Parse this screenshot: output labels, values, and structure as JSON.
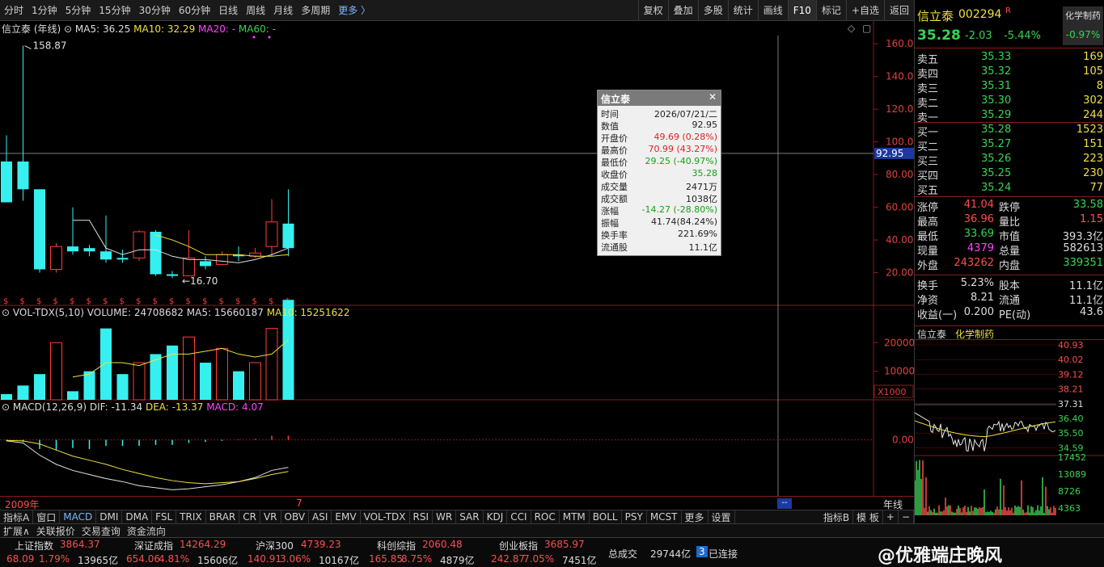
{
  "top_periods": [
    "分时",
    "1分钟",
    "5分钟",
    "15分钟",
    "30分钟",
    "60分钟",
    "日线",
    "周线",
    "月线",
    "多周期",
    "更多 〉"
  ],
  "top_tools": [
    "复权",
    "叠加",
    "多股",
    "统计",
    "画线",
    "F10",
    "标记",
    "+自选",
    "返回"
  ],
  "legend_main": {
    "name": "信立泰 (年线)",
    "ma5": "MA5: 36.25",
    "ma10": "MA10: 32.29",
    "ma20": "MA20: -",
    "ma60": "MA60: -"
  },
  "annotations": {
    "high": "158.87",
    "low": "16.70"
  },
  "price_axis": [
    "160.00",
    "140.00",
    "120.00",
    "100.00",
    "80.00",
    "60.00",
    "40.00",
    "20.00"
  ],
  "crosshair_value": "92.95",
  "legend_vol": {
    "name": "VOL-TDX(5,10)",
    "volume": "VOLUME: 24708682",
    "ma5": "MA5: 15660187",
    "ma10": "MA10: 15251622"
  },
  "vol_axis": [
    "20000",
    "10000"
  ],
  "vol_unit": "X1000",
  "legend_macd": {
    "name": "MACD(12,26,9)",
    "dif": "DIF: -11.34",
    "dea": "DEA: -13.37",
    "macd": "MACD: 4.07"
  },
  "macd_axis": "0.00",
  "time_axis": {
    "start": "2009年",
    "mark": "7"
  },
  "period_label": "年线",
  "tooltip": {
    "title": "信立泰",
    "rows": [
      {
        "k": "时间",
        "v": "2026/07/21/二",
        "c": "#222"
      },
      {
        "k": "数值",
        "v": "92.95",
        "c": "#222"
      },
      {
        "k": "开盘价",
        "v": "49.69 (0.28%)",
        "c": "#e02020"
      },
      {
        "k": "最高价",
        "v": "70.99 (43.27%)",
        "c": "#e02020"
      },
      {
        "k": "最低价",
        "v": "29.25 (-40.97%)",
        "c": "#14a014"
      },
      {
        "k": "收盘价",
        "v": "35.28",
        "c": "#14a014"
      },
      {
        "k": "成交量",
        "v": "2471万",
        "c": "#222"
      },
      {
        "k": "成交额",
        "v": "1038亿",
        "c": "#222"
      },
      {
        "k": "涨幅",
        "v": "-14.27 (-28.80%)",
        "c": "#14a014"
      },
      {
        "k": "振幅",
        "v": "41.74(84.24%)",
        "c": "#222"
      },
      {
        "k": "换手率",
        "v": "221.69%",
        "c": "#222"
      },
      {
        "k": "流通股",
        "v": "11.1亿",
        "c": "#222"
      }
    ]
  },
  "indicator_tabs": [
    "指标A",
    "窗口",
    "MACD",
    "DMI",
    "DMA",
    "FSL",
    "TRIX",
    "BRAR",
    "CR",
    "VR",
    "OBV",
    "ASI",
    "EMV",
    "VOL-TDX",
    "RSI",
    "WR",
    "SAR",
    "KDJ",
    "CCI",
    "ROC",
    "MTM",
    "BOLL",
    "PSY",
    "MCST",
    "更多",
    "设置"
  ],
  "indicator_right": [
    "指标B",
    "模 板",
    "+",
    "−"
  ],
  "bottom_tabs": [
    "扩展∧",
    "关联报价",
    "交易查询",
    "资金流向"
  ],
  "right_panel": {
    "name": "信立泰",
    "code": "002294",
    "tag": "R",
    "industry": "化学制药",
    "industry_change": "-0.97%",
    "price": "35.28",
    "change": "-2.03",
    "pct": "-5.44%",
    "asks": [
      {
        "l": "卖五",
        "p": "35.33",
        "v": "169"
      },
      {
        "l": "卖四",
        "p": "35.32",
        "v": "105"
      },
      {
        "l": "卖三",
        "p": "35.31",
        "v": "8"
      },
      {
        "l": "卖二",
        "p": "35.30",
        "v": "302"
      },
      {
        "l": "卖一",
        "p": "35.29",
        "v": "244"
      }
    ],
    "bids": [
      {
        "l": "买一",
        "p": "35.28",
        "v": "1523"
      },
      {
        "l": "买二",
        "p": "35.27",
        "v": "151"
      },
      {
        "l": "买三",
        "p": "35.26",
        "v": "223"
      },
      {
        "l": "买四",
        "p": "35.25",
        "v": "230"
      },
      {
        "l": "买五",
        "p": "35.24",
        "v": "77"
      }
    ],
    "stats": [
      {
        "a": "涨停",
        "av": "41.04",
        "ac": "red",
        "b": "跌停",
        "bv": "33.58",
        "bc": "grn"
      },
      {
        "a": "最高",
        "av": "36.96",
        "ac": "red",
        "b": "量比",
        "bv": "1.15",
        "bc": "red"
      },
      {
        "a": "最低",
        "av": "33.69",
        "ac": "grn",
        "b": "市值",
        "bv": "393.3亿",
        "bc": "wht"
      },
      {
        "a": "现量",
        "av": "4379",
        "ac": "mag",
        "b": "总量",
        "bv": "582613",
        "bc": "wht"
      },
      {
        "a": "外盘",
        "av": "243262",
        "ac": "red",
        "b": "内盘",
        "bv": "339351",
        "bc": "grn"
      }
    ],
    "stats2": [
      {
        "a": "换手",
        "av": "5.23%",
        "b": "股本",
        "bv": "11.1亿"
      },
      {
        "a": "净资",
        "av": "8.21",
        "b": "流通",
        "bv": "11.1亿"
      },
      {
        "a": "收益(一)",
        "av": "0.200",
        "b": "PE(动)",
        "bv": "43.6"
      }
    ],
    "mini_title": "信立泰",
    "mini_industry": "化学制药",
    "mini_axis": [
      "40.93",
      "40.02",
      "39.12",
      "38.21",
      "37.31",
      "36.40",
      "35.50",
      "34.59"
    ],
    "mini_vol_axis": [
      "17452",
      "13089",
      "8726",
      "4363"
    ]
  },
  "index_bar": [
    {
      "name": "上证指数",
      "val": "3864.37",
      "chg": "68.09",
      "pct": "1.79%",
      "amt": "13965亿"
    },
    {
      "name": "深证成指",
      "val": "14264.29",
      "chg": "654.06",
      "pct": "4.81%",
      "amt": "15606亿"
    },
    {
      "name": "沪深300",
      "val": "4739.23",
      "chg": "140.91",
      "pct": "3.06%",
      "amt": "10167亿"
    },
    {
      "name": "科创综指",
      "val": "2060.48",
      "chg": "165.85",
      "pct": "8.75%",
      "amt": "4879亿"
    },
    {
      "name": "创业板指",
      "val": "3685.97",
      "chg": "242.87",
      "pct": "7.05%",
      "amt": "7451亿"
    }
  ],
  "total_label": "总成交",
  "total_val": "29744亿",
  "conn_num": "3",
  "conn_label": "已连接",
  "watermark": "@优雅端庄晚风",
  "chart_data": {
    "type": "candlestick",
    "candles": [
      {
        "o": 88,
        "c": 63,
        "h": 104,
        "l": 63
      },
      {
        "o": 88,
        "c": 71,
        "h": 158.87,
        "l": 64
      },
      {
        "o": 71,
        "c": 22,
        "h": 71,
        "l": 20
      },
      {
        "o": 22,
        "c": 36,
        "h": 38,
        "l": 20
      },
      {
        "o": 36,
        "c": 33,
        "h": 60,
        "l": 31
      },
      {
        "o": 35,
        "c": 33,
        "h": 37,
        "l": 30
      },
      {
        "o": 33,
        "c": 28,
        "h": 55,
        "l": 26
      },
      {
        "o": 29,
        "c": 28,
        "h": 34,
        "l": 26
      },
      {
        "o": 29,
        "c": 45,
        "h": 46,
        "l": 27
      },
      {
        "o": 45,
        "c": 19,
        "h": 46,
        "l": 18
      },
      {
        "o": 19,
        "c": 18,
        "h": 21,
        "l": 16.7
      },
      {
        "o": 18,
        "c": 29,
        "h": 46,
        "l": 18
      },
      {
        "o": 27,
        "c": 24,
        "h": 30,
        "l": 22
      },
      {
        "o": 25,
        "c": 31,
        "h": 33,
        "l": 25
      },
      {
        "o": 31,
        "c": 30,
        "h": 36,
        "l": 27
      },
      {
        "o": 30,
        "c": 32,
        "h": 35,
        "l": 29
      },
      {
        "o": 36,
        "c": 51,
        "h": 65,
        "l": 30
      },
      {
        "o": 50,
        "c": 35,
        "h": 71,
        "l": 30
      }
    ],
    "ma5": [
      null,
      null,
      null,
      null,
      52,
      52,
      35,
      31,
      34,
      34,
      30,
      28,
      28,
      27,
      26,
      28,
      31,
      35
    ],
    "ma10": [
      null,
      null,
      null,
      null,
      null,
      null,
      null,
      null,
      null,
      43,
      40,
      36,
      31,
      31,
      31,
      30,
      30,
      31
    ],
    "volume": [
      2,
      5,
      9,
      20,
      3,
      10,
      25,
      9,
      13,
      16,
      19,
      22,
      13,
      18,
      10,
      13,
      25,
      35
    ],
    "vol_ma5": [
      null,
      null,
      null,
      null,
      8,
      9,
      13,
      13,
      12,
      14,
      16,
      16,
      17,
      18,
      16,
      15,
      16,
      21
    ],
    "macd_hist": [
      -1,
      -2,
      -9,
      -10,
      -8,
      -9,
      -6,
      -6,
      -6,
      -5,
      -5,
      -3,
      -2,
      -1,
      0.5,
      1,
      4,
      4.07
    ],
    "dif": [
      -1,
      -3,
      -15,
      -24,
      -30,
      -34,
      -38,
      -41,
      -45,
      -47,
      -49,
      -48,
      -46,
      -44,
      -41,
      -37,
      -30,
      -27
    ],
    "dea": [
      -0.5,
      -1,
      -4,
      -10,
      -16,
      -20,
      -24,
      -29,
      -33,
      -37,
      -40,
      -42,
      -43,
      -42,
      -41,
      -38,
      -34,
      -31
    ],
    "price_range": [
      0,
      170
    ],
    "vol_range": [
      0,
      28
    ],
    "macd_range": [
      -55,
      25
    ]
  }
}
